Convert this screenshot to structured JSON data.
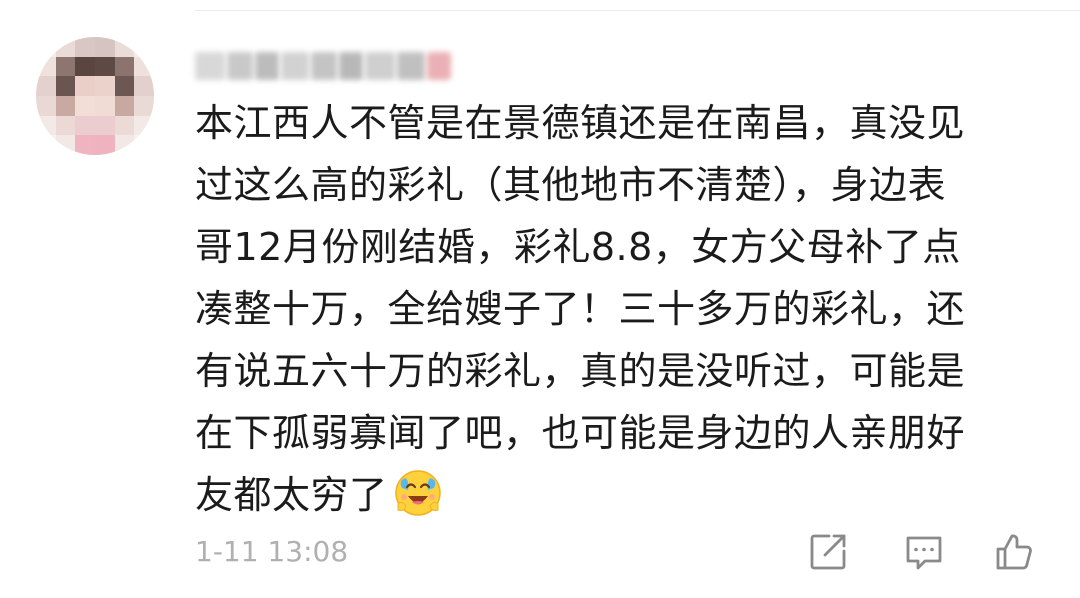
{
  "comment": {
    "lines": [
      "本江西人不管是在景德镇还是在南昌，真没见",
      "过这么高的彩礼（其他地市不清楚），身边表",
      "哥12月份刚结婚，彩礼8.8，女方父母补了点",
      "凑整十万，全给嫂子了！三十多万的彩礼，还",
      "有说五六十万的彩礼，真的是没听过，可能是",
      "在下孤弱寡闻了吧，也可能是身边的人亲朋好",
      "友都太穷了"
    ],
    "emoji": "crying-laughing-emoji",
    "timestamp": "1-11 13:08"
  },
  "actions": {
    "share_icon": "share-icon",
    "comment_icon": "comment-icon",
    "like_icon": "thumbs-up-icon"
  },
  "colors": {
    "text": "#1b1b1b",
    "meta": "#b0b0b0",
    "icon": "#8a8a8a"
  }
}
